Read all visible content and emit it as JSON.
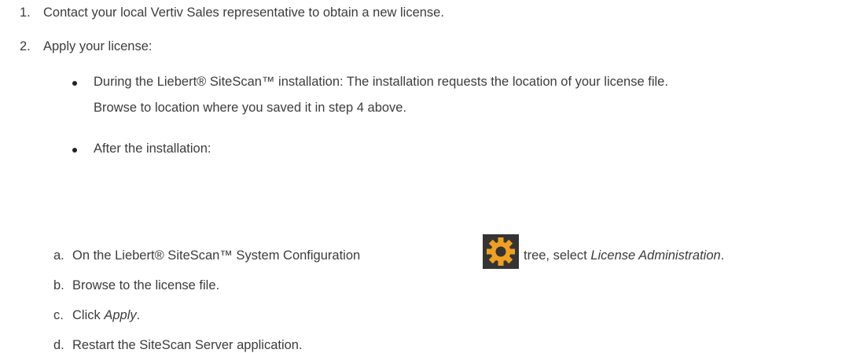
{
  "steps": [
    {
      "number": "1.",
      "text": "Contact your local Vertiv Sales representative to obtain a new license."
    },
    {
      "number": "2.",
      "text": "Apply your license:"
    }
  ],
  "bullets": [
    {
      "line1": "During the Liebert® SiteScan™ installation: The installation requests the location of your license file.",
      "line2": "Browse to location where you saved it in step 4 above."
    },
    {
      "line1": "After the installation:"
    }
  ],
  "substeps": {
    "a": {
      "letter": "a.",
      "before_icon": "On the Liebert® SiteScan™ System Configuration",
      "icon": "gear-icon",
      "icon_color": "#f0a020",
      "icon_bg": "#343434",
      "after_icon": "tree, select",
      "emphasis": "License Administration",
      "end": "."
    },
    "b": {
      "letter": "b.",
      "text": "Browse to the license file."
    },
    "c": {
      "letter": "c.",
      "prefix": "Click",
      "emphasis": "Apply",
      "end": "."
    },
    "d": {
      "letter": "d.",
      "text": "Restart the SiteScan Server application."
    }
  }
}
